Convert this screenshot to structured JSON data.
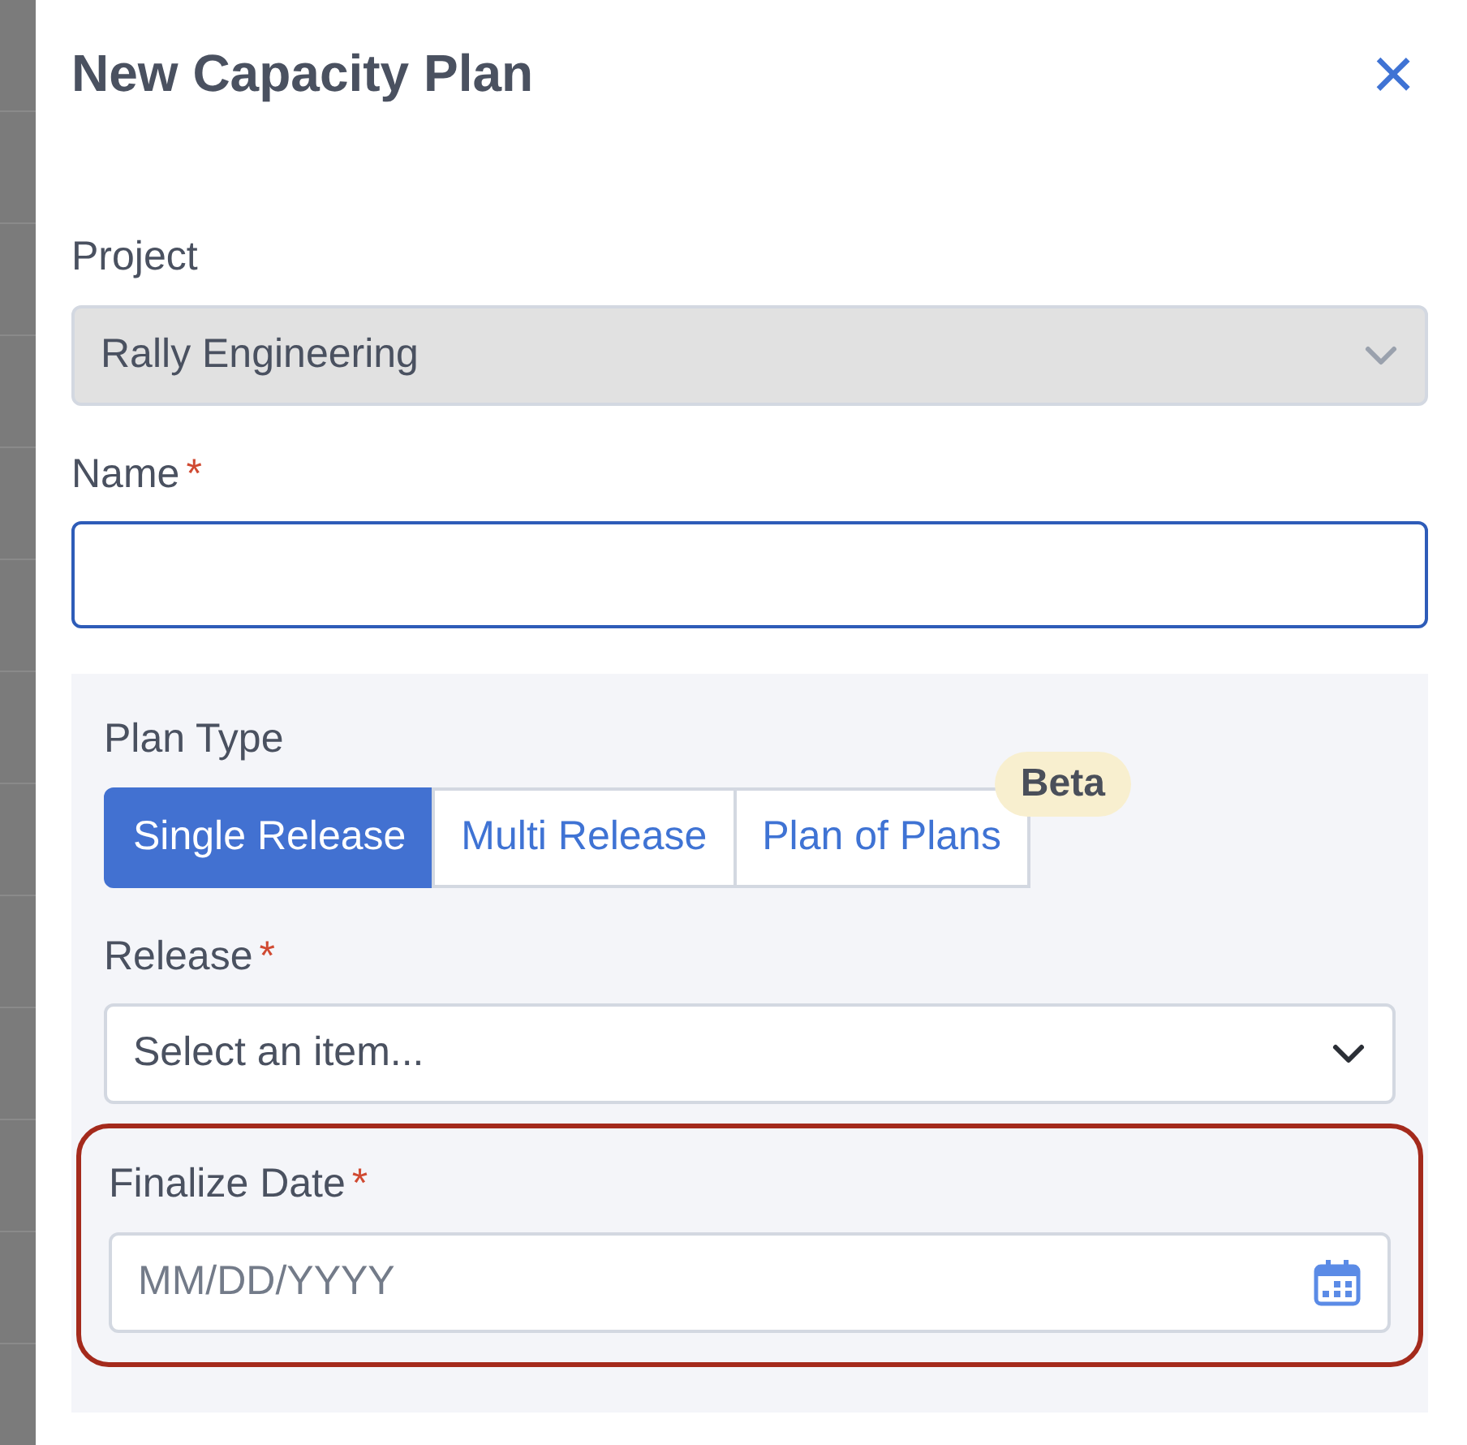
{
  "dialog": {
    "title": "New Capacity Plan",
    "close": "×"
  },
  "project": {
    "label": "Project",
    "value": "Rally Engineering",
    "disabled": true
  },
  "name": {
    "label": "Name",
    "required": "*",
    "focused": true
  },
  "plan_type": {
    "label": "Plan Type",
    "options": [
      {
        "label": "Single Release",
        "selected": true
      },
      {
        "label": "Multi Release",
        "selected": false
      },
      {
        "label": "Plan of Plans",
        "selected": false,
        "badge": "Beta"
      }
    ]
  },
  "release": {
    "label": "Release",
    "required": "*",
    "placeholder": "Select an item..."
  },
  "finalize_date": {
    "label": "Finalize Date",
    "required": "*",
    "placeholder": "MM/DD/YYYY",
    "highlighted": true
  }
}
